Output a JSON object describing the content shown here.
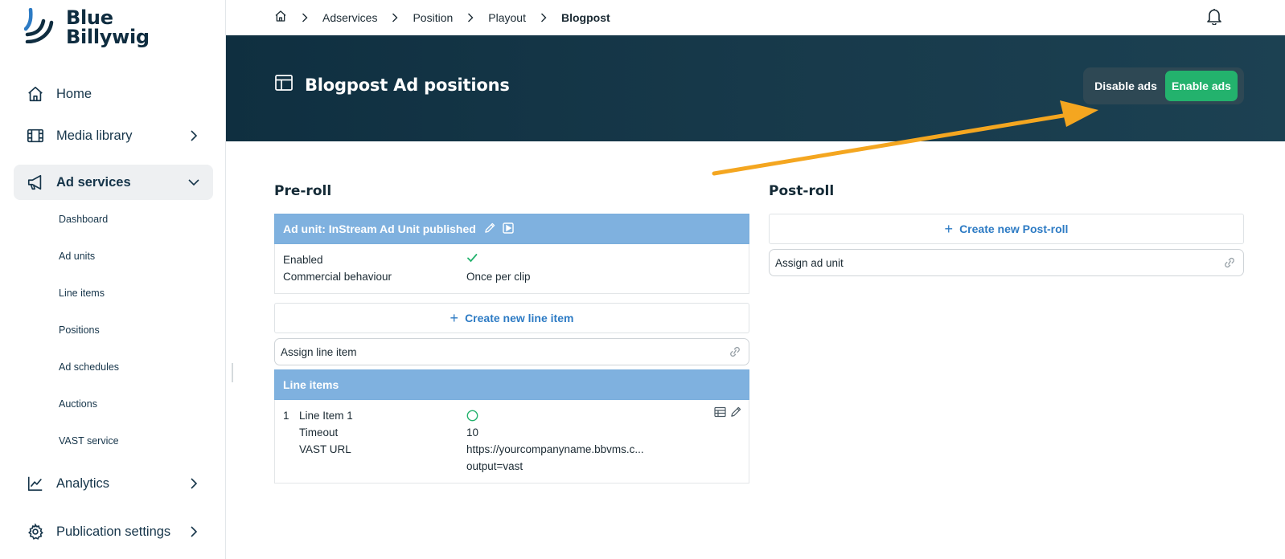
{
  "brand": {
    "line1": "Blue",
    "line2": "Billywig"
  },
  "sidebar": {
    "items": [
      {
        "label": "Home",
        "icon": "home-icon",
        "has_chevron": false
      },
      {
        "label": "Media library",
        "icon": "film-icon",
        "has_chevron": true
      },
      {
        "label": "Ad services",
        "icon": "megaphone-icon",
        "has_chevron": true,
        "active": true
      },
      {
        "label": "Analytics",
        "icon": "chart-line-icon",
        "has_chevron": true
      },
      {
        "label": "Publication settings",
        "icon": "gear-icon",
        "has_chevron": true
      }
    ],
    "sub_items": [
      "Dashboard",
      "Ad units",
      "Line items",
      "Positions",
      "Ad schedules",
      "Auctions",
      "VAST service"
    ]
  },
  "breadcrumb": [
    "Adservices",
    "Position",
    "Playout",
    "Blogpost"
  ],
  "header": {
    "title": "Blogpost Ad positions",
    "disable_label": "Disable ads",
    "enable_label": "Enable ads"
  },
  "preroll": {
    "title": "Pre-roll",
    "ad_unit_header": "Ad unit: InStream Ad Unit published",
    "enabled_label": "Enabled",
    "behaviour_label": "Commercial behaviour",
    "behaviour_value": "Once per clip",
    "create_line_item": "Create new line item",
    "assign_line_item": "Assign line item",
    "line_items_header": "Line items",
    "line_items": [
      {
        "index": "1",
        "name": "Line Item 1",
        "timeout_label": "Timeout",
        "timeout_value": "10",
        "vast_label": "VAST URL",
        "vast_value_line1": "https://yourcompanyname.bbvms.c...",
        "vast_value_line2": "output=vast"
      }
    ]
  },
  "postroll": {
    "title": "Post-roll",
    "create_label": "Create new Post-roll",
    "assign_label": "Assign ad unit"
  },
  "colors": {
    "header_bg": "#0f2f40",
    "accent_green": "#23b26d",
    "card_header_blue": "#7fb1df",
    "link_blue": "#2d7bc4",
    "annotation_arrow": "#f4a620"
  }
}
